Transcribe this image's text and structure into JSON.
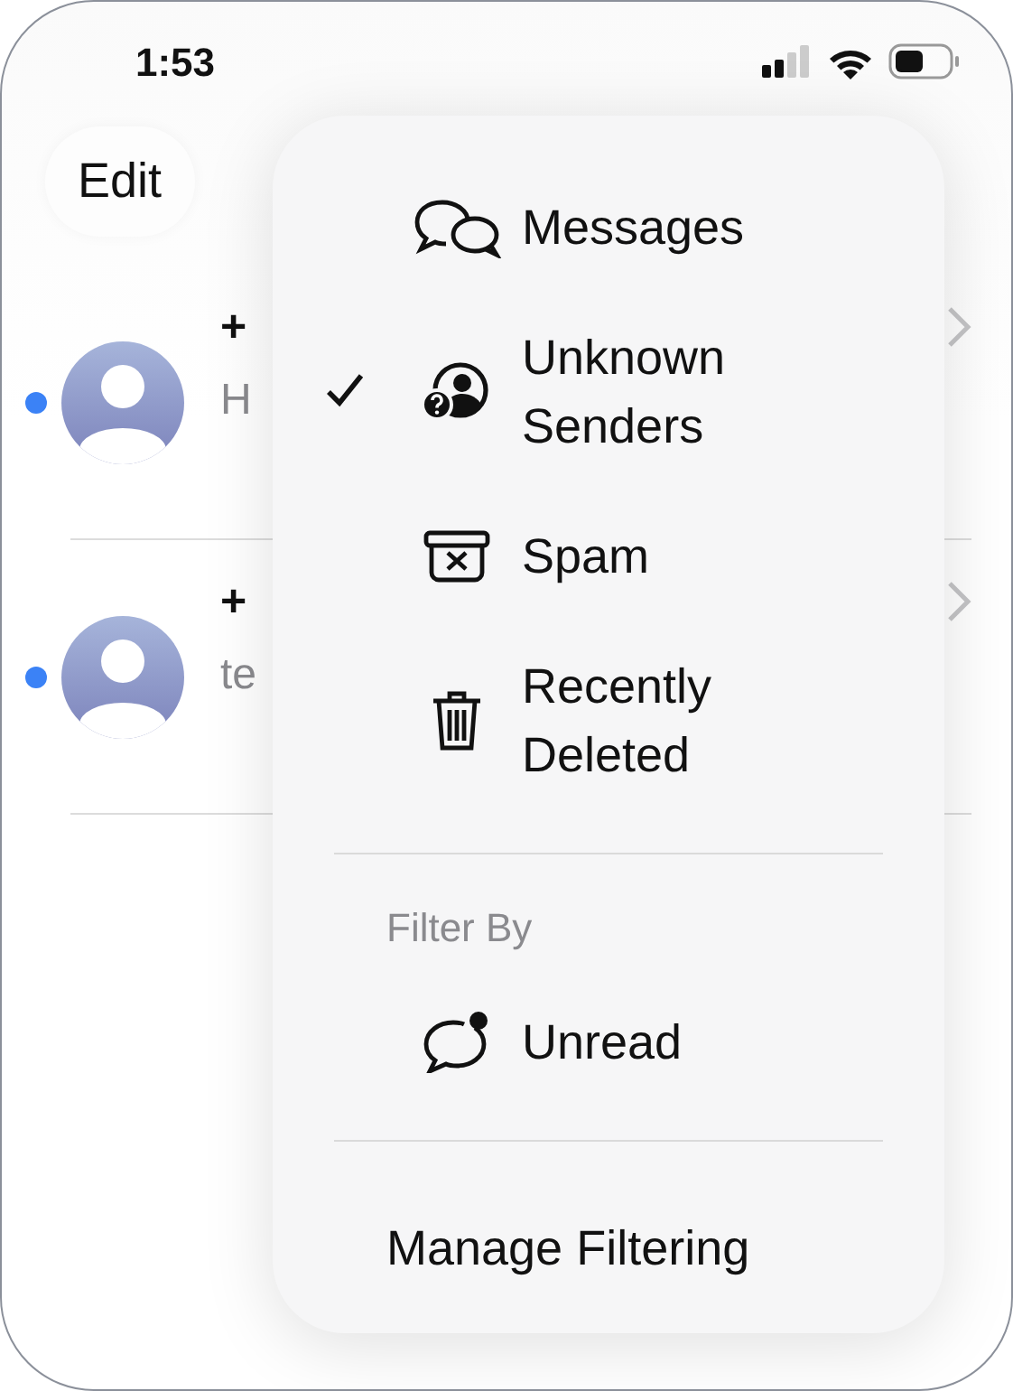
{
  "status_bar": {
    "time": "1:53"
  },
  "nav": {
    "edit": "Edit"
  },
  "conversations": [
    {
      "name": "+",
      "preview": "H",
      "unread": true
    },
    {
      "name": "+",
      "preview": "te",
      "unread": true
    }
  ],
  "menu": {
    "items": [
      {
        "label": "Messages",
        "kind": "messages",
        "selected": false
      },
      {
        "label": "Unknown Senders",
        "kind": "unknown",
        "selected": true
      },
      {
        "label": "Spam",
        "kind": "spam",
        "selected": false
      },
      {
        "label": "Recently Deleted",
        "kind": "trash",
        "selected": false
      }
    ],
    "filter_header": "Filter By",
    "filters": [
      {
        "label": "Unread",
        "kind": "unread",
        "selected": false
      }
    ],
    "footer": "Manage Filtering"
  }
}
